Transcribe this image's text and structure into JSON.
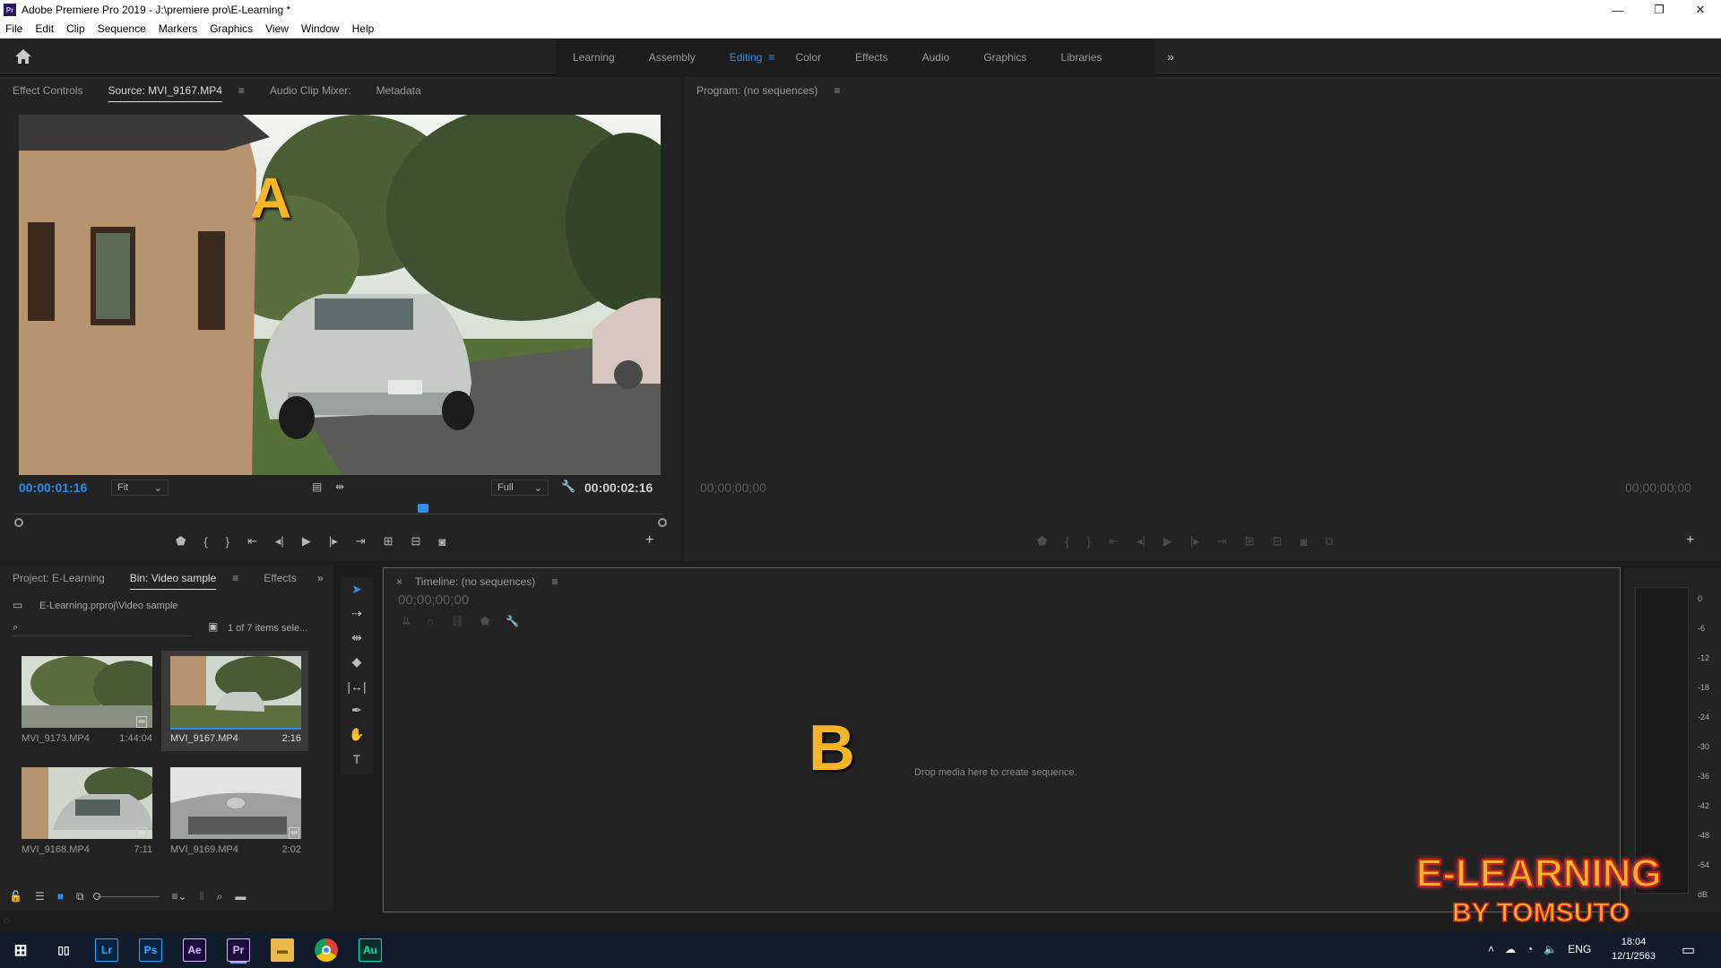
{
  "window": {
    "title": "Adobe Premiere Pro 2019 - J:\\premiere pro\\E-Learning *",
    "app_badge": "Pr",
    "minimize": "—",
    "restore": "❐",
    "close": "✕"
  },
  "menu": [
    "File",
    "Edit",
    "Clip",
    "Sequence",
    "Markers",
    "Graphics",
    "View",
    "Window",
    "Help"
  ],
  "workspaces": {
    "tabs": [
      "Learning",
      "Assembly",
      "Editing",
      "Color",
      "Effects",
      "Audio",
      "Graphics",
      "Libraries"
    ],
    "active": "Editing",
    "more": "»"
  },
  "source_panel": {
    "tabs": [
      "Effect Controls",
      "Source: MVI_9167.MP4",
      "Audio Clip Mixer:",
      "Metadata"
    ],
    "active_tab": "Source: MVI_9167.MP4",
    "overlay_letter": "A",
    "timecode_current": "00:00:01:16",
    "zoom": "Fit",
    "resolution": "Full",
    "timecode_duration": "00:00:02:16",
    "playhead_fraction": 0.63
  },
  "program_panel": {
    "title": "Program: (no sequences)",
    "timecode_left": "00;00;00;00",
    "timecode_right": "00;00;00;00"
  },
  "project_panel": {
    "tabs": [
      "Project: E-Learning",
      "Bin: Video sample",
      "Effects"
    ],
    "active_tab": "Bin: Video sample",
    "path": "E-Learning.prproj\\Video sample",
    "selection_status": "1 of 7 items sele...",
    "clips": [
      {
        "name": "MVI_9173.MP4",
        "duration": "1:44:04"
      },
      {
        "name": "MVI_9167.MP4",
        "duration": "2:16"
      },
      {
        "name": "MVI_9168.MP4",
        "duration": "7:11"
      },
      {
        "name": "MVI_9169.MP4",
        "duration": "2:02"
      }
    ]
  },
  "timeline_panel": {
    "title": "Timeline: (no sequences)",
    "close": "×",
    "timecode": "00;00;00;00",
    "overlay_letter": "B",
    "drop_hint": "Drop media here to create sequence."
  },
  "audio_meter": {
    "labels": [
      "0",
      "-6",
      "-12",
      "-18",
      "-24",
      "-30",
      "-36",
      "-42",
      "-48",
      "-54",
      "dB"
    ]
  },
  "watermark": {
    "line1": "E-LEARNING",
    "line2": "BY TOMSUTO"
  },
  "taskbar": {
    "apps": [
      {
        "name": "Lr",
        "color": "#31a8ff"
      },
      {
        "name": "Ps",
        "color": "#31a8ff"
      },
      {
        "name": "Ae",
        "color": "#d7b8ff"
      },
      {
        "name": "Pr",
        "color": "#d7b8ff"
      },
      {
        "name": "Au",
        "color": "#00e4bb"
      }
    ],
    "language": "ENG",
    "time": "18:04",
    "date": "12/1/2563"
  }
}
